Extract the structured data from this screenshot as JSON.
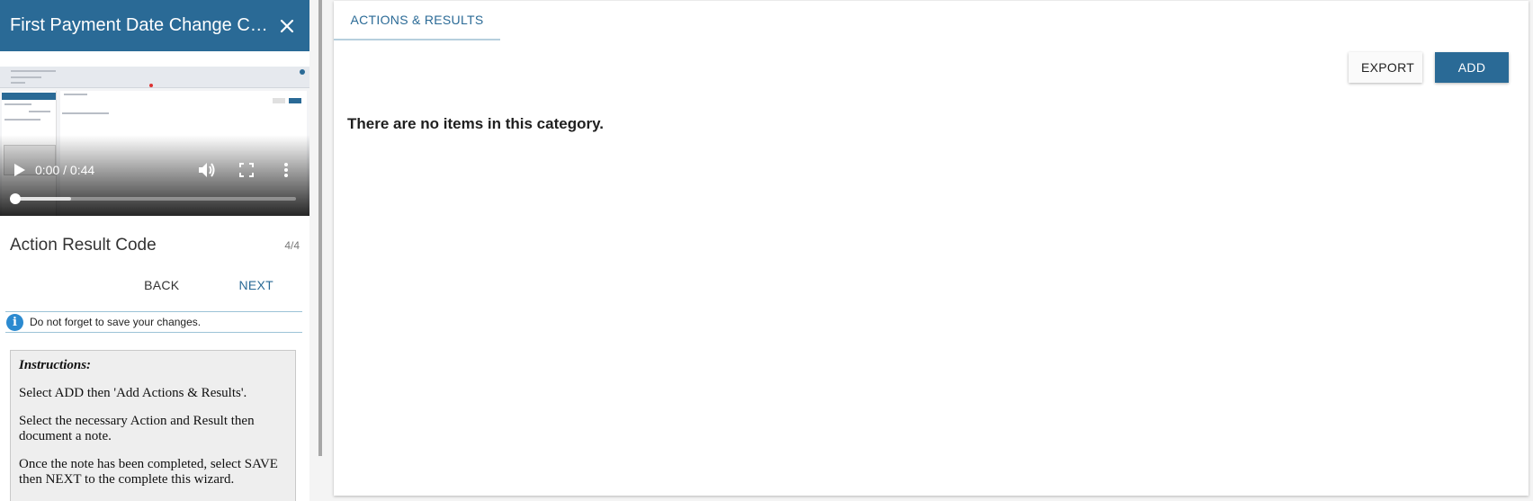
{
  "wizard": {
    "title": "First Payment Date Change Co…",
    "close_icon": "close-icon",
    "video": {
      "time": "0:00 / 0:44",
      "played_fraction": 0.0,
      "buffered_fraction": 0.2,
      "icons": [
        "play-icon",
        "volume-icon",
        "fullscreen-icon",
        "more-vert-icon"
      ]
    },
    "step_title": "Action Result Code",
    "step_count": "4/4",
    "back_label": "BACK",
    "next_label": "NEXT",
    "info_text": "Do not forget to save your changes.",
    "instructions": {
      "heading": "Instructions:",
      "lines": [
        "Select ADD then 'Add Actions & Results'.",
        "Select the necessary Action and Result then document a note.",
        "Once the note has been completed, select SAVE then NEXT to the complete this wizard."
      ]
    }
  },
  "main": {
    "tab_label": "ACTIONS & RESULTS",
    "export_label": "EXPORT",
    "add_label": "ADD",
    "empty_message": "There are no items in this category."
  },
  "colors": {
    "primary": "#2a6a96",
    "info": "#2b8ad0"
  }
}
